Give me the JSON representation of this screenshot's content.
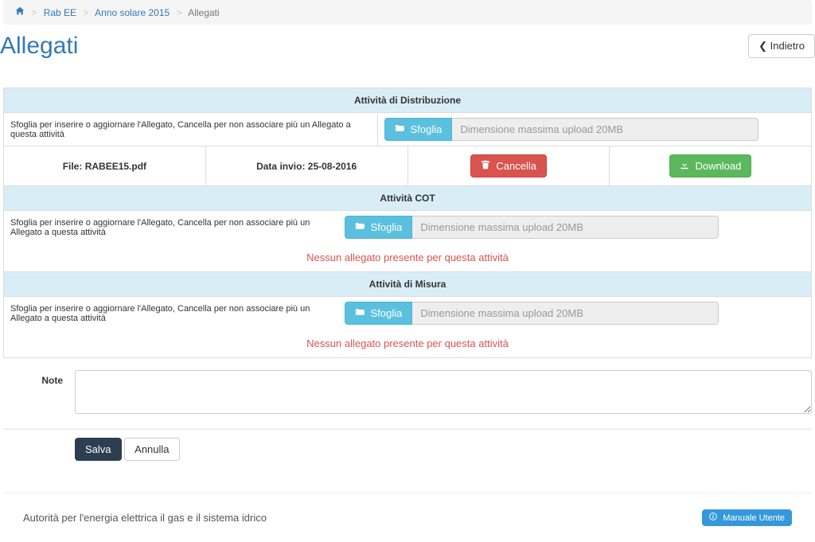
{
  "breadcrumb": {
    "item1": "Rab EE",
    "item2": "Anno solare 2015",
    "item3": "Allegati"
  },
  "page": {
    "title": "Allegati",
    "back_label": "Indietro"
  },
  "sections": {
    "dist": {
      "header": "Attività di Distribuzione",
      "instruction": "Sfoglia per inserire o aggiornare l'Allegato, Cancella per non associare più un Allegato a questa attività",
      "browse_label": "Sfoglia",
      "placeholder": "Dimensione massima upload 20MB",
      "file_label": "File: RABEE15.pdf",
      "date_label": "Data invio: 25-08-2016",
      "delete_label": "Cancella",
      "download_label": "Download"
    },
    "cot": {
      "header": "Attività COT",
      "instruction": "Sfoglia per inserire o aggiornare l'Allegato, Cancella per non associare più un Allegato a questa attività",
      "browse_label": "Sfoglia",
      "placeholder": "Dimensione massima upload 20MB",
      "no_attach": "Nessun allegato presente per questa attività"
    },
    "mis": {
      "header": "Attività di Misura",
      "instruction": "Sfoglia per inserire o aggiornare l'Allegato, Cancella per non associare più un Allegato a questa attività",
      "browse_label": "Sfoglia",
      "placeholder": "Dimensione massima upload 20MB",
      "no_attach": "Nessun allegato presente per questa attività"
    }
  },
  "note": {
    "label": "Note"
  },
  "actions": {
    "save": "Salva",
    "cancel": "Annulla"
  },
  "footer": {
    "authority": "Autorità per l'energia elettrica il gas e il sistema idrico",
    "manual": "Manuale Utente"
  }
}
